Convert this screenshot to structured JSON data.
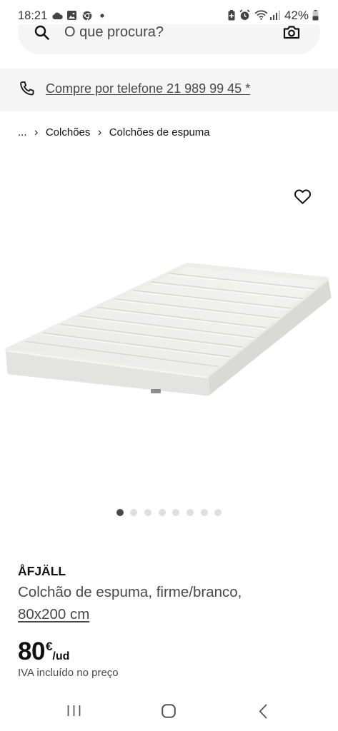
{
  "status_bar": {
    "time": "18:21",
    "battery_level": "42%",
    "icons": {
      "cloud": "cloud-icon",
      "gallery": "gallery-icon",
      "browser": "chrome-icon",
      "notification": "notification-dot",
      "battery_saver": "battery-saver-icon",
      "alarm": "alarm-icon",
      "wifi": "wifi-icon",
      "signal": "signal-icon",
      "battery": "battery-icon"
    }
  },
  "search": {
    "placeholder": "O que procura?",
    "icon": "search-icon",
    "visual_search_icon": "camera-icon"
  },
  "phone_banner": {
    "icon": "phone-icon",
    "text": "Compre por telefone 21 989 99 45 *"
  },
  "breadcrumb": {
    "separator": "›",
    "items": [
      "...",
      "Colchões",
      "Colchões de espuma"
    ]
  },
  "gallery": {
    "favorite_icon": "heart-icon",
    "slide_count": 8,
    "active_slide": 1
  },
  "product": {
    "name": "ÅFJÄLL",
    "description": "Colchão de espuma, firme/branco,",
    "size": "80x200 cm",
    "price": {
      "amount": "80",
      "currency": "€",
      "unit": "/ud"
    },
    "tax_note": "IVA incluído no preço"
  },
  "nav_bar": {
    "recent": "recent-apps-icon",
    "home": "home-icon",
    "back": "back-icon"
  },
  "colors": {
    "text_primary": "#111111",
    "text_secondary": "#484848",
    "panel_background": "#f5f5f5",
    "dot_active": "#484848",
    "dot_inactive": "#dfdfdf"
  }
}
